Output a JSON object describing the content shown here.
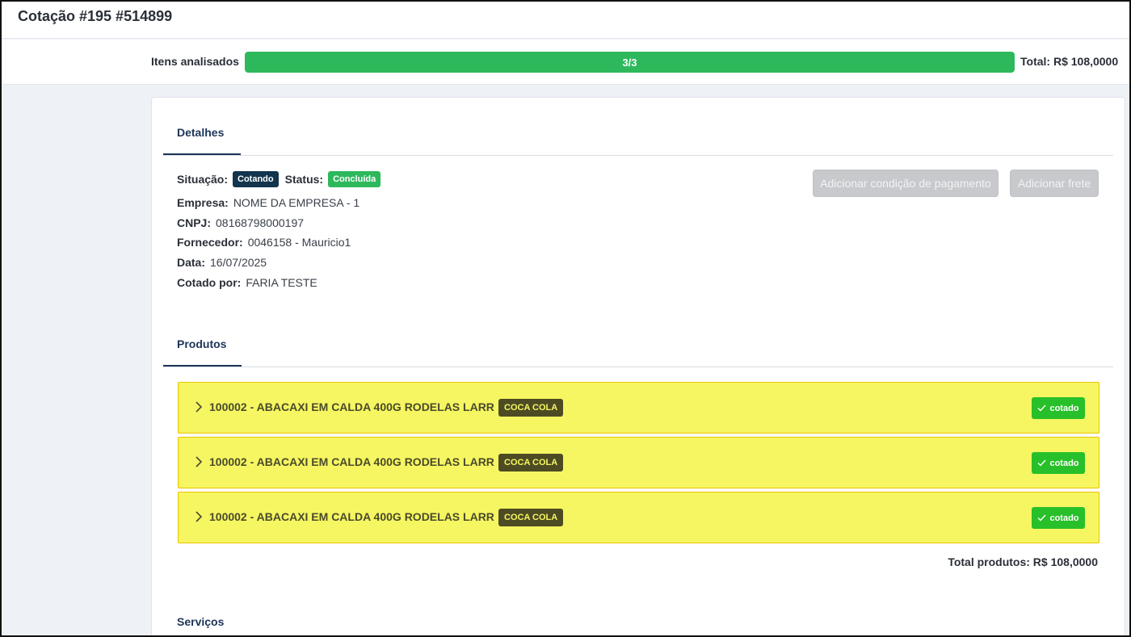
{
  "header": {
    "title": "Cotação #195 #514899"
  },
  "progress": {
    "label": "Itens analisados",
    "text": "3/3",
    "fraction": 1.0,
    "total": "Total: R$ 108,0000"
  },
  "details": {
    "tab_label": "Detalhes",
    "situacao_label": "Situação:",
    "situacao_value": "Cotando",
    "status_label": "Status:",
    "status_value": "Concluída",
    "fields": [
      {
        "label": "Empresa:",
        "value": "NOME DA EMPRESA - 1"
      },
      {
        "label": "CNPJ:",
        "value": "08168798000197"
      },
      {
        "label": "Fornecedor:",
        "value": "0046158 - Mauricio1"
      },
      {
        "label": "Data:",
        "value": "16/07/2025"
      },
      {
        "label": "Cotado por:",
        "value": "FARIA TESTE"
      }
    ],
    "buttons": {
      "payment_condition": "Adicionar condição de pagamento",
      "freight": "Adicionar frete"
    }
  },
  "products": {
    "tab_label": "Produtos",
    "items": [
      {
        "name": "100002 - ABACAXI EM CALDA 400G RODELAS LARR",
        "brand": "COCA COLA",
        "status": "cotado"
      },
      {
        "name": "100002 - ABACAXI EM CALDA 400G RODELAS LARR",
        "brand": "COCA COLA",
        "status": "cotado"
      },
      {
        "name": "100002 - ABACAXI EM CALDA 400G RODELAS LARR",
        "brand": "COCA COLA",
        "status": "cotado"
      }
    ],
    "total": "Total produtos: R$ 108,0000"
  },
  "services": {
    "tab_label": "Serviços"
  },
  "colors": {
    "accent_navy": "#1d3557",
    "success_green": "#2eb85c",
    "highlight_yellow": "#f6f662"
  },
  "icons": {
    "expand": "chevron-right-icon",
    "check": "check-icon"
  }
}
